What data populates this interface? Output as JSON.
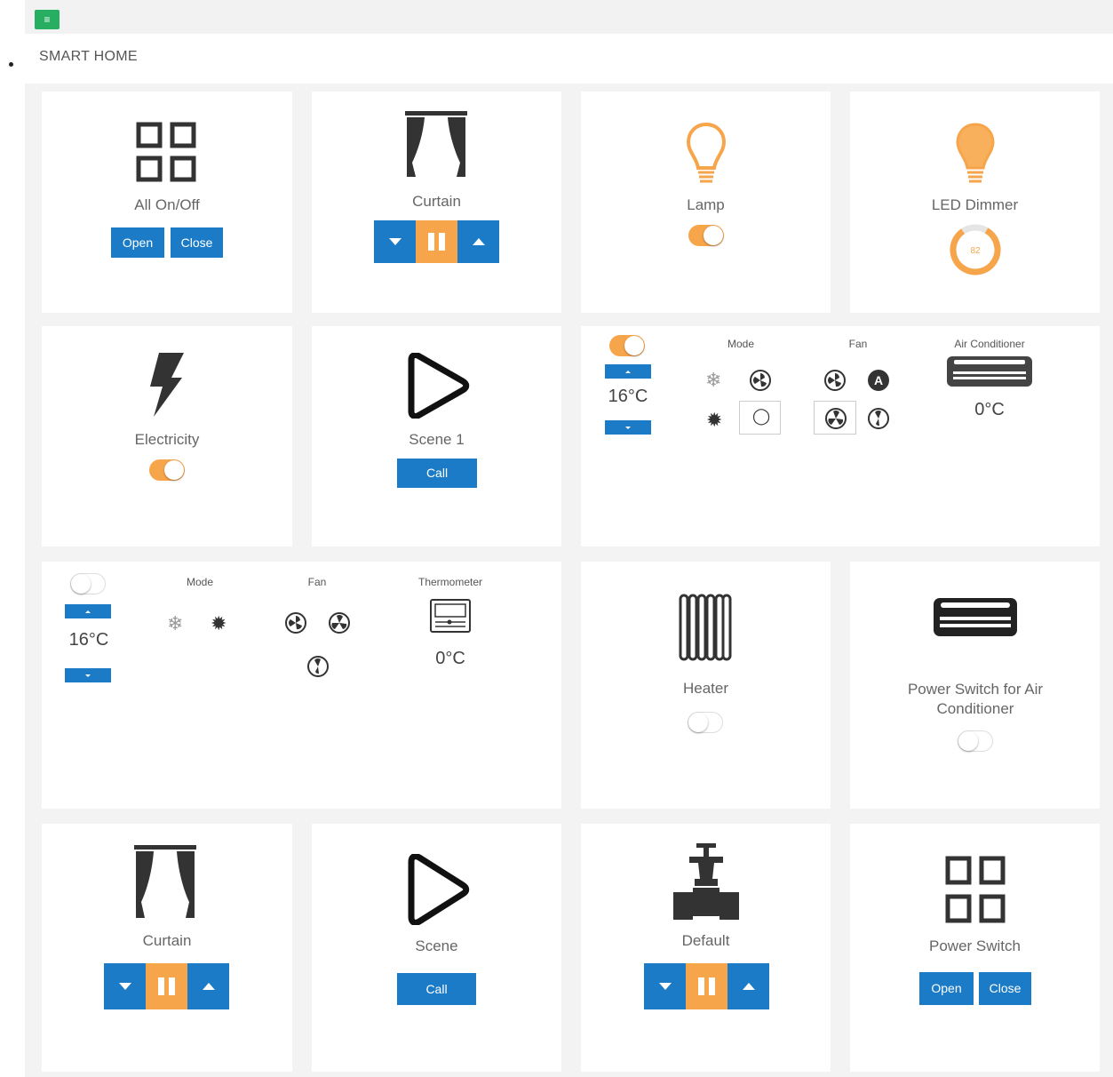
{
  "header": {
    "menu_icon": "hamburger-icon",
    "title": "SMART HOME"
  },
  "colors": {
    "accent_blue": "#1b7bc6",
    "accent_orange": "#f7a54b",
    "menu_green": "#27ae60"
  },
  "tiles": {
    "all_onoff": {
      "label": "All On/Off",
      "open": "Open",
      "close": "Close",
      "icon": "grid-icon"
    },
    "curtain1": {
      "label": "Curtain",
      "icon": "curtain-icon"
    },
    "lamp": {
      "label": "Lamp",
      "icon": "bulb-icon",
      "state": "on"
    },
    "led_dimmer": {
      "label": "LED Dimmer",
      "value": "82",
      "icon": "bulb-glow-icon"
    },
    "electricity": {
      "label": "Electricity",
      "icon": "lightning-icon",
      "state": "on"
    },
    "scene1": {
      "label": "Scene 1",
      "call": "Call",
      "icon": "play-icon"
    },
    "ac": {
      "mode_label": "Mode",
      "fan_label": "Fan",
      "title": "Air Conditioner",
      "set_temp": "16°C",
      "current_temp": "0°C",
      "power": "on"
    },
    "thermo": {
      "mode_label": "Mode",
      "fan_label": "Fan",
      "title": "Thermometer",
      "set_temp": "16°C",
      "current_temp": "0°C",
      "power": "off"
    },
    "heater": {
      "label": "Heater",
      "icon": "radiator-icon",
      "state": "off"
    },
    "ac_power": {
      "label": "Power Switch for Air Conditioner",
      "icon": "air-conditioner-icon",
      "state": "off"
    },
    "curtain2": {
      "label": "Curtain",
      "icon": "curtain-icon"
    },
    "scene": {
      "label": "Scene",
      "call": "Call",
      "icon": "play-icon"
    },
    "default": {
      "label": "Default",
      "icon": "valve-icon"
    },
    "power_switch": {
      "label": "Power Switch",
      "open": "Open",
      "close": "Close",
      "icon": "grid-icon"
    }
  }
}
